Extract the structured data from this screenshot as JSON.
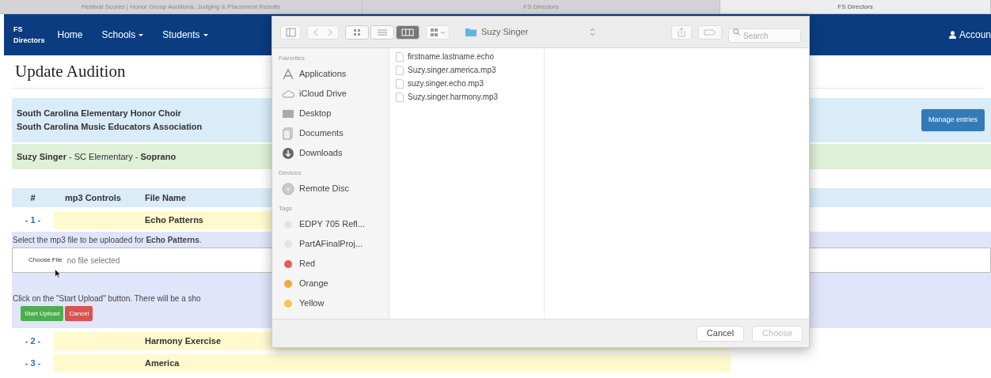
{
  "browser_tabs": [
    {
      "label": "Festival Scores | Honor Group Auditions, Judging & Placement Results",
      "selected": false
    },
    {
      "label": "FS Directors",
      "selected": false
    },
    {
      "label": "FS Directors",
      "selected": true
    }
  ],
  "navbar": {
    "brand": [
      "FS",
      "Directors"
    ],
    "items": [
      {
        "label": "Home",
        "dropdown": false
      },
      {
        "label": "Schools",
        "dropdown": true
      },
      {
        "label": "Students",
        "dropdown": true
      }
    ],
    "account": "Accoun"
  },
  "page_title": "Update Audition",
  "event": {
    "lines": [
      "South Carolina Elementary Honor Choir",
      "South Carolina Music Educators Association"
    ],
    "button": "Manage entries"
  },
  "student": "**Suzy Singer** - SC Elementary - **Soprano**",
  "table": {
    "columns": [
      "#",
      "mp3 Controls",
      "File Name"
    ],
    "rows": [
      {
        "number": "- 1 -",
        "file_name": "Echo Patterns",
        "expanded": true
      },
      {
        "number": "- 2 -",
        "file_name": "Harmony Exercise",
        "expanded": false
      },
      {
        "number": "- 3 -",
        "file_name": "America",
        "expanded": false
      }
    ]
  },
  "upload": {
    "instruction": "Select the mp3 file to be uploaded for **Echo Patterns**.",
    "file_button": "Choose File",
    "file_status": "no file selected",
    "hint": "Click on the \"Start Upload\" button. There will be a sho",
    "buttons": [
      {
        "label": "Start Upload",
        "kind": "success"
      },
      {
        "label": "Cancel",
        "kind": "danger"
      }
    ]
  },
  "dialog": {
    "view_modes": [
      {
        "kind": "icons",
        "selected": false
      },
      {
        "kind": "list",
        "selected": false
      },
      {
        "kind": "columns",
        "selected": true
      }
    ],
    "location": "Suzy Singer",
    "search_placeholder": "Search",
    "sidebar": [
      {
        "heading": "Favorites",
        "items": [
          {
            "label": "Applications",
            "kind": "applications"
          },
          {
            "label": "iCloud Drive",
            "kind": "cloud"
          },
          {
            "label": "Desktop",
            "kind": "desktop"
          },
          {
            "label": "Documents",
            "kind": "documents"
          },
          {
            "label": "Downloads",
            "kind": "downloads"
          }
        ]
      },
      {
        "heading": "Devices",
        "items": [
          {
            "label": "Remote Disc",
            "kind": "disc"
          }
        ]
      },
      {
        "heading": "Tags",
        "items": [
          {
            "label": "EDPY 705 Refl...",
            "kind": "tag",
            "color": "#e4e4e4"
          },
          {
            "label": "PartAFinalProj...",
            "kind": "tag",
            "color": "#e4e4e4"
          },
          {
            "label": "Red",
            "kind": "tag",
            "color": "#ec5b57"
          },
          {
            "label": "Orange",
            "kind": "tag",
            "color": "#f2a93b"
          },
          {
            "label": "Yellow",
            "kind": "tag",
            "color": "#f5c84c"
          }
        ]
      }
    ],
    "files": [
      {
        "name": "firstname.lastname.echo"
      },
      {
        "name": "Suzy.singer.america.mp3"
      },
      {
        "name": "suzy.singer.echo.mp3"
      },
      {
        "name": "Suzy.singer.harmony.mp3"
      }
    ],
    "buttons": [
      {
        "label": "Cancel",
        "disabled": false
      },
      {
        "label": "Choose",
        "disabled": true
      }
    ]
  }
}
